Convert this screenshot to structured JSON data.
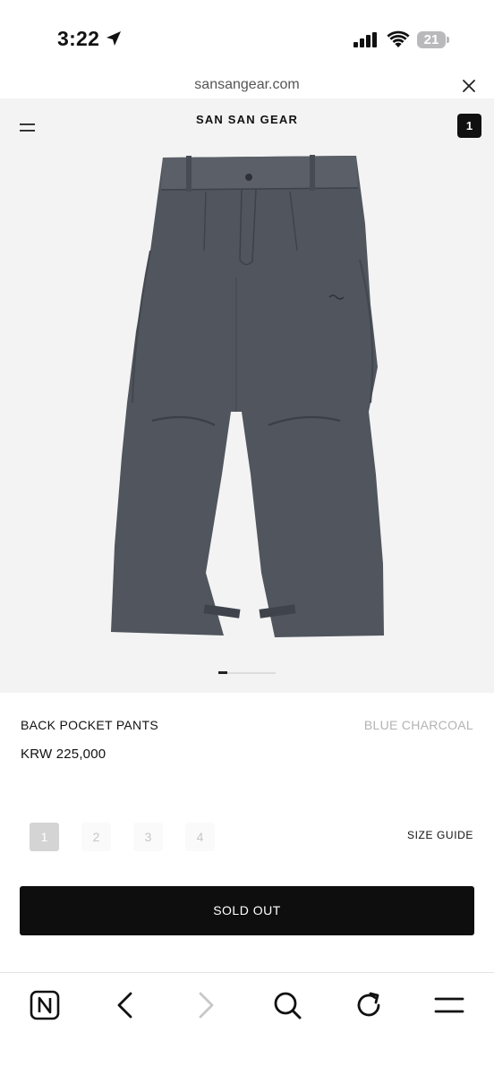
{
  "status_bar": {
    "time": "3:22",
    "battery": "21",
    "icons": [
      "location-arrow-icon",
      "signal-icon",
      "wifi-icon",
      "battery-icon"
    ]
  },
  "url_bar": {
    "url": "sansangear.com",
    "close_icon": "close-icon"
  },
  "header": {
    "brand": "SAN SAN GEAR",
    "menu_icon": "menu-icon",
    "cart_count": "1"
  },
  "product": {
    "image_alt": "grey wide-leg pleated pants",
    "name": "BACK POCKET PANTS",
    "color": "BLUE CHARCOAL",
    "price": "KRW 225,000",
    "carousel": {
      "active_index": 1,
      "total": 6
    }
  },
  "sizes": {
    "options": [
      "1",
      "2",
      "3",
      "4"
    ],
    "selected": "1",
    "guide_label": "SIZE GUIDE"
  },
  "cta": {
    "label": "SOLD OUT"
  },
  "toolbar": {
    "icons": [
      "n-logo-icon",
      "back-icon",
      "forward-icon",
      "search-icon",
      "reload-icon",
      "menu-icon"
    ]
  },
  "colors": {
    "button_bg": "#0e0e0e",
    "product_bg": "#f3f3f3",
    "pants": "#50555e",
    "muted_text": "#b3b3b3"
  }
}
